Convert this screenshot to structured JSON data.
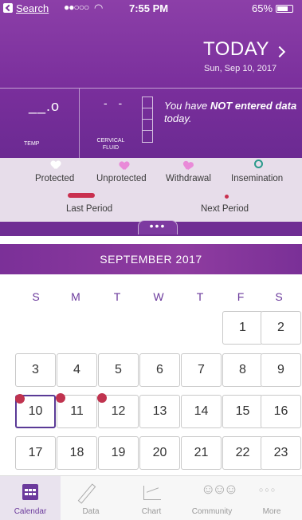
{
  "status": {
    "back_label": "Search",
    "signal": "●●○○○",
    "time": "7:55 PM",
    "battery": "65%"
  },
  "header": {
    "title": "TODAY",
    "date": "Sun, Sep 10, 2017"
  },
  "metrics": {
    "temp_value": "__.o",
    "temp_label": "TEMP",
    "cervical_value": "- -",
    "cervical_label_1": "CERVICAL",
    "cervical_label_2": "FLUID",
    "message_prefix": "You have ",
    "message_bold": "NOT entered data",
    "message_suffix": " today."
  },
  "legend": {
    "protected": "Protected",
    "unprotected": "Unprotected",
    "withdrawal": "Withdrawal",
    "insemination": "Insemination",
    "last_period": "Last Period",
    "next_period": "Next Period",
    "period_color": "#c9304f"
  },
  "handle": "•••",
  "calendar": {
    "month_label": "SEPTEMBER 2017",
    "weekdays": [
      "S",
      "M",
      "T",
      "W",
      "T",
      "F",
      "S"
    ],
    "days": [
      "1",
      "2",
      "3",
      "4",
      "5",
      "6",
      "7",
      "8",
      "9",
      "10",
      "11",
      "12",
      "13",
      "14",
      "15",
      "16",
      "17",
      "18",
      "19",
      "20",
      "21",
      "22",
      "23"
    ],
    "today": "10",
    "period_days": [
      "10",
      "11",
      "12"
    ]
  },
  "tabs": [
    {
      "label": "Calendar",
      "icon": "calendar-icon"
    },
    {
      "label": "Data",
      "icon": "pencil-icon"
    },
    {
      "label": "Chart",
      "icon": "chart-icon"
    },
    {
      "label": "Community",
      "icon": "community-icon"
    },
    {
      "label": "More",
      "icon": "more-icon"
    }
  ],
  "colors": {
    "header_purple": "#7a2f9c",
    "accent": "#6b3a9c",
    "legend_bg": "#e7ddea"
  }
}
